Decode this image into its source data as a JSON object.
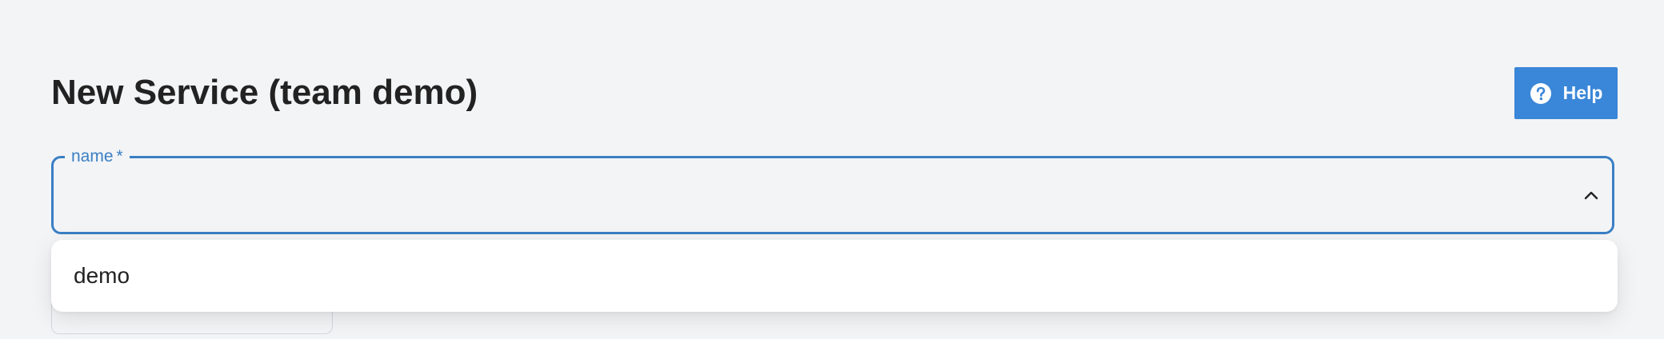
{
  "header": {
    "title": "New Service (team demo)",
    "help_label": "Help"
  },
  "form": {
    "name_field": {
      "label": "name",
      "required_marker": "*",
      "value": ""
    }
  },
  "dropdown": {
    "options": [
      {
        "label": "demo"
      }
    ]
  },
  "colors": {
    "accent": "#3a86d8",
    "field_border": "#3a7fc4",
    "background": "#f3f4f6"
  },
  "icons": {
    "help": "question-circle-icon",
    "field_toggle": "chevron-up-icon"
  }
}
